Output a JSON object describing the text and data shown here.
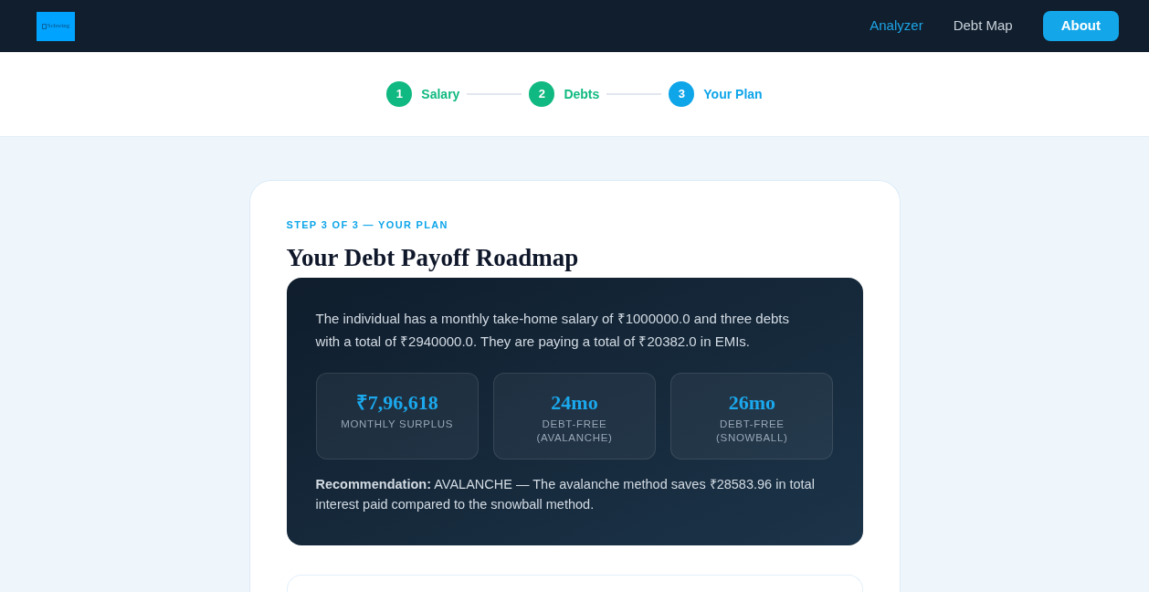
{
  "header": {
    "logo": {
      "alt_text": "Schwing"
    },
    "nav": [
      {
        "label": "Analyzer",
        "kind": "link",
        "selected": true
      },
      {
        "label": "Debt Map",
        "kind": "link",
        "selected": false
      },
      {
        "label": "About",
        "kind": "button",
        "selected": false
      }
    ]
  },
  "stepper": [
    {
      "number": "1",
      "label": "Salary",
      "selected": false
    },
    {
      "number": "2",
      "label": "Debts",
      "selected": false
    },
    {
      "number": "3",
      "label": "Your Plan",
      "selected": true
    }
  ],
  "card": {
    "eyebrow": "STEP 3 OF 3 — YOUR PLAN",
    "title": "Your Debt Payoff Roadmap",
    "summary": {
      "text": "The individual has a monthly take-home salary of ₹1000000.0 and three debts with a total of ₹2940000.0. They are paying a total of ₹20382.0 in EMIs.",
      "stats": [
        {
          "value": "₹7,96,618",
          "label": "MONTHLY SURPLUS"
        },
        {
          "value": "24mo",
          "label": "DEBT-FREE (AVALANCHE)"
        },
        {
          "value": "26mo",
          "label": "DEBT-FREE (SNOWBALL)"
        }
      ],
      "recommendation": "**Recommendation:** AVALANCHE — The avalanche method saves ₹28583.96 in total interest paid compared to the snowball method."
    }
  }
}
